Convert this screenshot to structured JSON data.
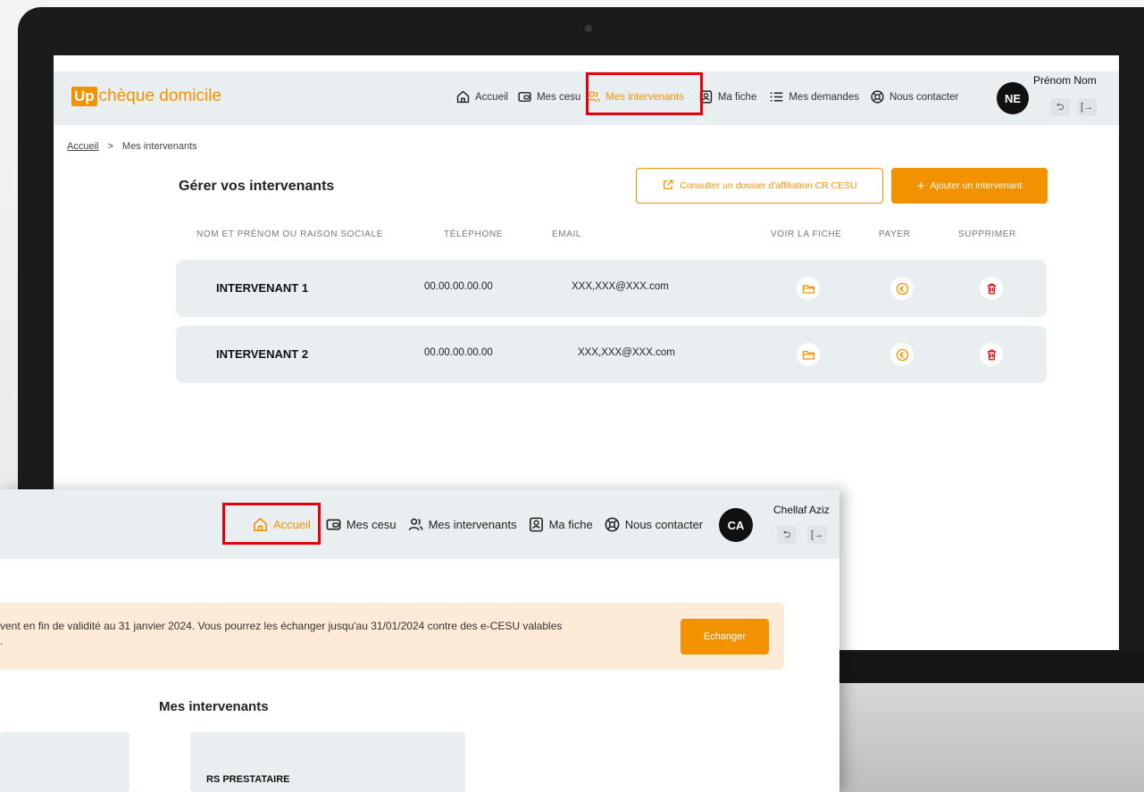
{
  "main": {
    "logo": {
      "badge": "Up",
      "text": "chèque domicile"
    },
    "nav": [
      {
        "label": "Accueil",
        "icon": "home-icon"
      },
      {
        "label": "Mes cesu",
        "icon": "wallet-icon"
      },
      {
        "label": "Mes intervenants",
        "icon": "users-icon",
        "active": true
      },
      {
        "label": "Ma fiche",
        "icon": "id-card-icon"
      },
      {
        "label": "Mes demandes",
        "icon": "list-icon"
      },
      {
        "label": "Nous contacter",
        "icon": "lifebuoy-icon"
      }
    ],
    "user": {
      "initials": "NE",
      "name": "Prénom Nom"
    },
    "breadcrumb": {
      "home": "Accueil",
      "separator": ">",
      "current": "Mes intervenants"
    },
    "page_title": "Gérer vos intervenants",
    "btn_affiliation": "Consulter un dossier d'affiliation CR CESU",
    "btn_add": "Ajouter un intervenant",
    "btn_add_icon": "+",
    "columns": [
      "NOM ET PRÉNOM OU RAISON SOCIALE",
      "TÉLÉPHONE",
      "EMAIL",
      "VOIR LA FICHE",
      "PAYER",
      "SUPPRIMER"
    ],
    "rows": [
      {
        "name": "INTERVENANT 1",
        "phone": "00.00.00.00.00",
        "email": "XXX,XXX@XXX.com"
      },
      {
        "name": "INTERVENANT 2",
        "phone": "00.00.00.00.00",
        "email": "XXX,XXX@XXX.com"
      }
    ]
  },
  "overlay": {
    "nav": [
      {
        "label": "Accueil",
        "icon": "home-icon",
        "active": true
      },
      {
        "label": "Mes cesu",
        "icon": "wallet-icon"
      },
      {
        "label": "Mes intervenants",
        "icon": "users-icon"
      },
      {
        "label": "Ma fiche",
        "icon": "id-card-icon"
      },
      {
        "label": "Nous contacter",
        "icon": "lifebuoy-icon"
      }
    ],
    "user": {
      "initials": "CA",
      "name": "Chellaf Aziz"
    },
    "banner_line1": "vent en fin de validité au 31 janvier 2024. Vous pourrez les échanger jusqu'au 31/01/2024 contre des e-CESU valables",
    "banner_line2": ".",
    "btn_echanger": "Echanger",
    "section_title": "Mes intervenants",
    "card_label": "RS PRESTATAIRE"
  },
  "colors": {
    "accent": "#f39200",
    "highlight": "#e3000f",
    "header_bg": "#e9eef0",
    "danger": "#e3000f"
  }
}
